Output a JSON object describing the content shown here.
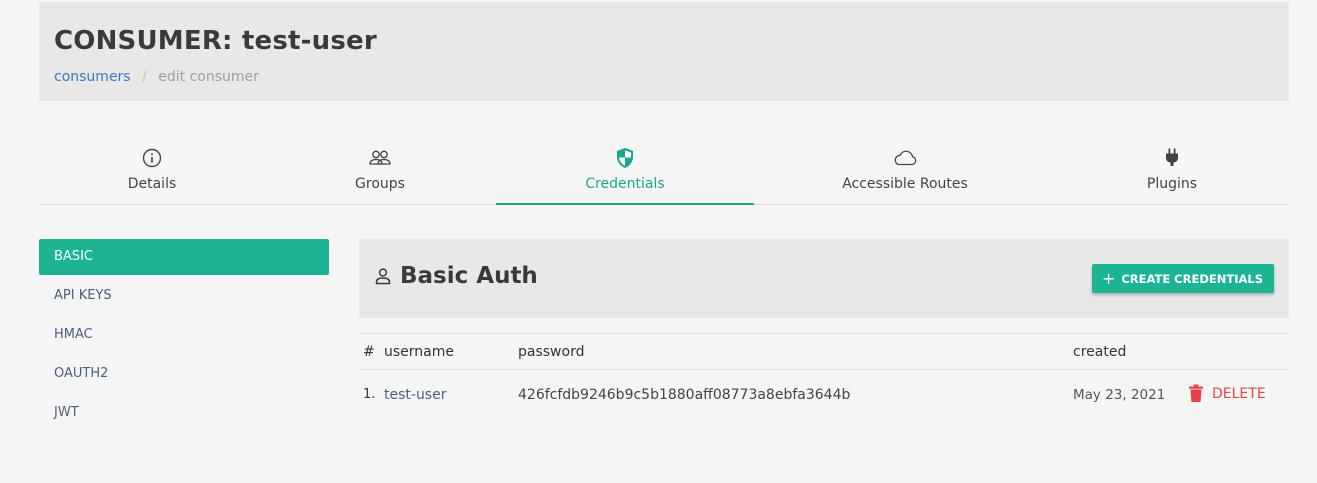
{
  "header": {
    "title": "CONSUMER: test-user",
    "breadcrumb": {
      "link": "consumers",
      "separator": "/",
      "current": "edit consumer"
    }
  },
  "tabs": [
    {
      "label": "Details",
      "icon": "info-circle-icon",
      "active": false
    },
    {
      "label": "Groups",
      "icon": "users-icon",
      "active": false
    },
    {
      "label": "Credentials",
      "icon": "shield-icon",
      "active": true
    },
    {
      "label": "Accessible Routes",
      "icon": "cloud-icon",
      "active": false
    },
    {
      "label": "Plugins",
      "icon": "plug-icon",
      "active": false
    }
  ],
  "sidenav": {
    "items": [
      {
        "label": "BASIC",
        "active": true
      },
      {
        "label": "API KEYS",
        "active": false
      },
      {
        "label": "HMAC",
        "active": false
      },
      {
        "label": "OAUTH2",
        "active": false
      },
      {
        "label": "JWT",
        "active": false
      }
    ]
  },
  "panel": {
    "title": "Basic Auth",
    "title_icon": "user-icon",
    "create_button": {
      "icon": "+",
      "label": "CREATE CREDENTIALS"
    }
  },
  "table": {
    "headers": {
      "num": "#",
      "username": "username",
      "password": "password",
      "created": "created"
    },
    "rows": [
      {
        "num": "1.",
        "username": "test-user",
        "password": "426fcfdb9246b9c5b1880aff08773a8ebfa3644b",
        "created": "May 23, 2021",
        "delete_label": "DELETE"
      }
    ]
  },
  "colors": {
    "accent": "#1cb493",
    "link": "#3b7bbf",
    "danger": "#e8434a",
    "header_bg": "#e8e8e8",
    "page_bg": "#f5f5f5"
  }
}
